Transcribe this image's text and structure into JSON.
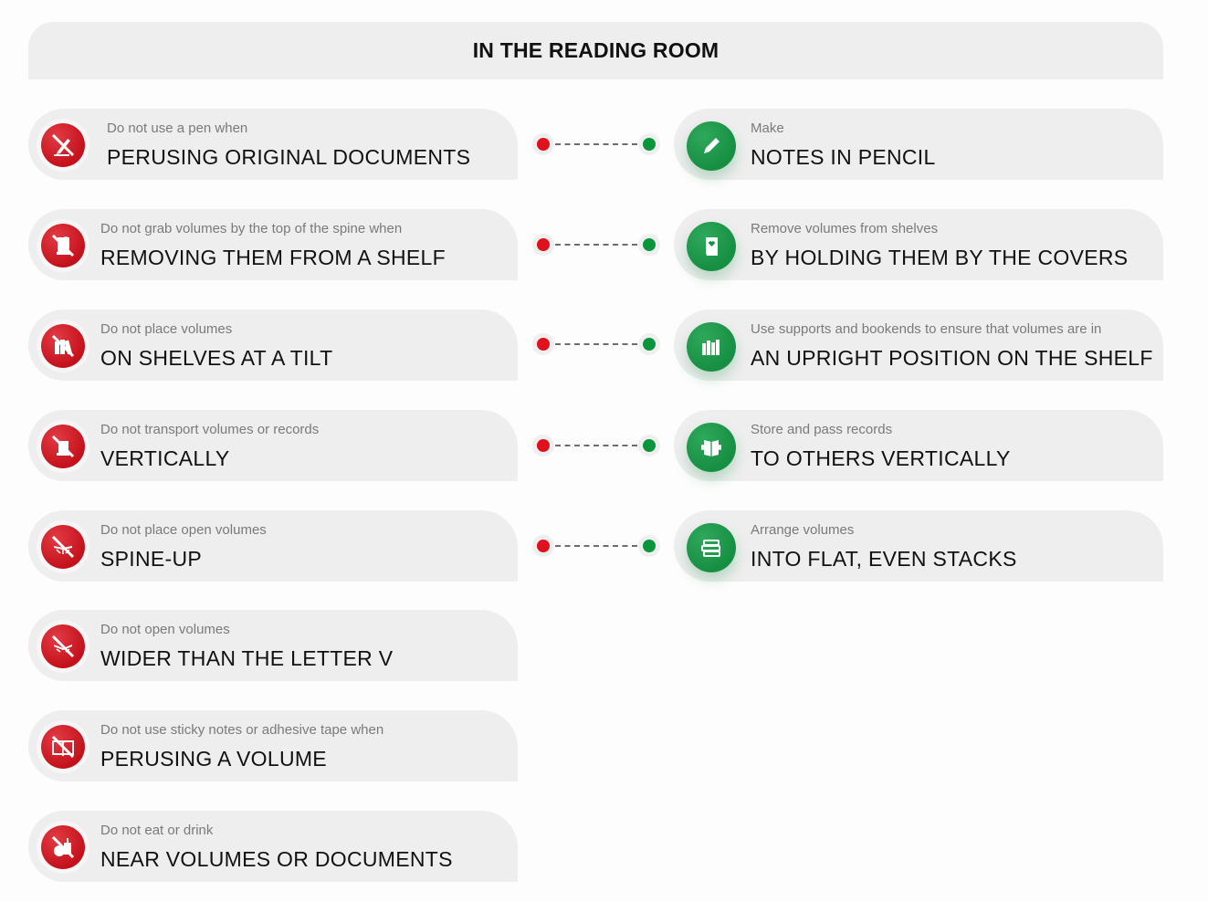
{
  "title": "IN THE READING ROOM",
  "colors": {
    "dont": "#e0101c",
    "do": "#08953c",
    "card_bg": "#eeeeee",
    "sub_text": "#7a7a7a",
    "main_text": "#111111"
  },
  "donts": [
    {
      "icon": "no-pen-icon",
      "sub": "Do not use a pen when",
      "main": "PERUSING ORIGINAL DOCUMENTS"
    },
    {
      "icon": "no-spine-grab-icon",
      "sub": "Do not grab volumes by the top of the spine when",
      "main": "REMOVING THEM FROM A SHELF"
    },
    {
      "icon": "no-tilted-books-icon",
      "sub": "Do not place volumes",
      "main": "ON SHELVES AT A TILT"
    },
    {
      "icon": "no-vertical-transport-icon",
      "sub": "Do not transport volumes or records",
      "main": "VERTICALLY"
    },
    {
      "icon": "no-spine-up-icon",
      "sub": "Do not place open volumes",
      "main": "SPINE-UP"
    },
    {
      "icon": "no-wide-open-icon",
      "sub": "Do not open volumes",
      "main": "WIDER THAN THE LETTER V"
    },
    {
      "icon": "no-sticky-notes-icon",
      "sub": "Do not use sticky notes or adhesive tape when",
      "main": "PERUSING A VOLUME"
    },
    {
      "icon": "no-food-drink-icon",
      "sub": "Do not eat or drink",
      "main": "NEAR VOLUMES OR DOCUMENTS"
    }
  ],
  "dos": [
    {
      "icon": "pencil-icon",
      "sub": "Make",
      "main": "NOTES IN PENCIL"
    },
    {
      "icon": "book-cover-icon",
      "sub": "Remove volumes from shelves",
      "main": "BY HOLDING THEM BY THE COVERS"
    },
    {
      "icon": "upright-books-icon",
      "sub": "Use supports and bookends to ensure that volumes are in",
      "main": "AN UPRIGHT POSITION ON THE SHELF"
    },
    {
      "icon": "open-book-hands-icon",
      "sub": "Store and pass records",
      "main": "TO OTHERS VERTICALLY"
    },
    {
      "icon": "book-stack-icon",
      "sub": "Arrange volumes",
      "main": "INTO FLAT, EVEN STACKS"
    }
  ]
}
